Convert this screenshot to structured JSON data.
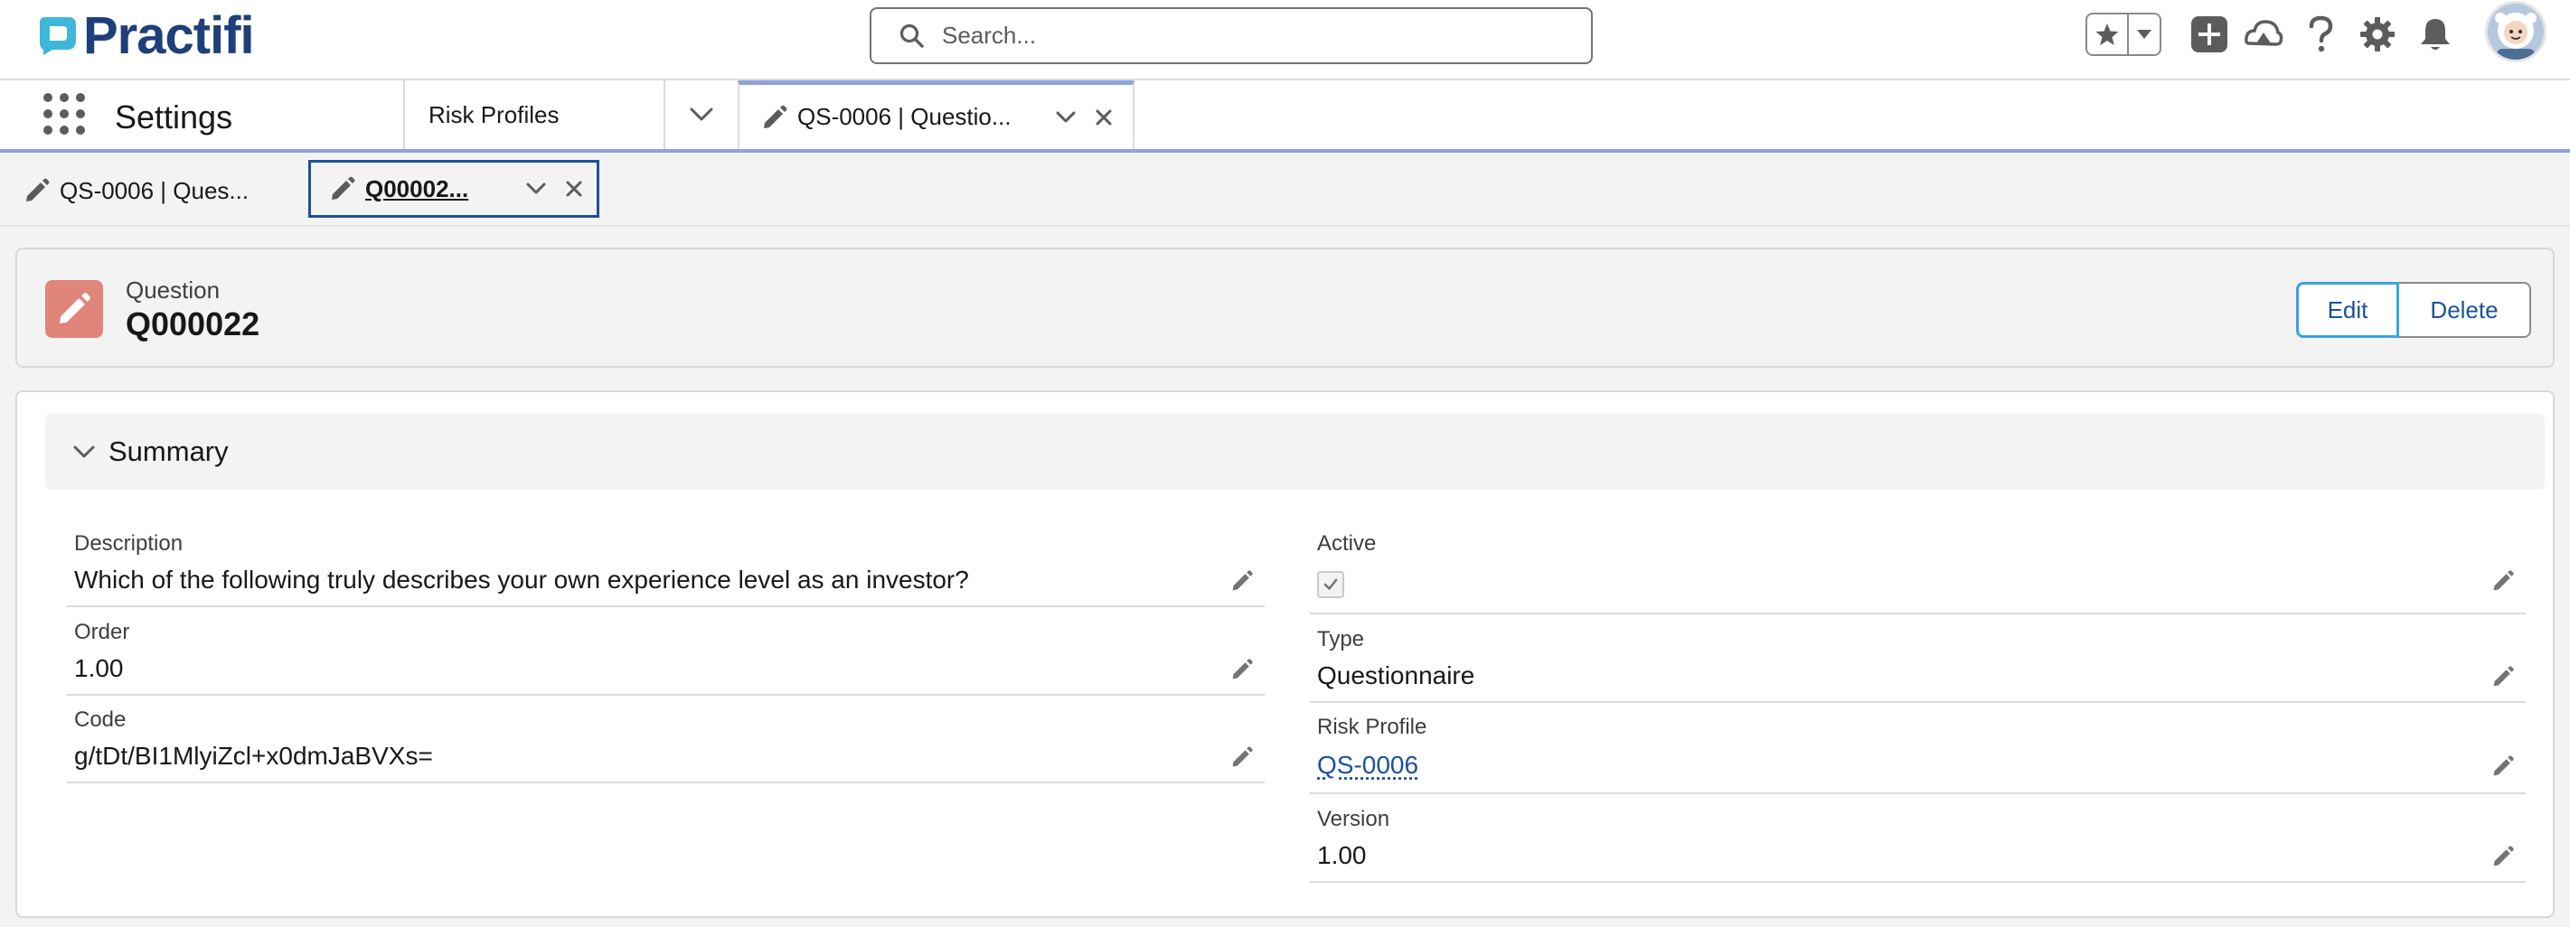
{
  "header": {
    "logo_text": "Practifi",
    "search": {
      "placeholder": "Search..."
    },
    "icons": [
      "favorites-star-icon",
      "chevron-down-icon",
      "add-icon",
      "trailhead-icon",
      "help-icon",
      "setup-gear-icon",
      "notifications-bell-icon",
      "avatar"
    ]
  },
  "app_nav": {
    "app_name": "Settings",
    "tabs": [
      {
        "label": "Risk Profiles"
      },
      {
        "label": "QS-0006 | Questio..."
      }
    ]
  },
  "subtabs": [
    {
      "label": "QS-0006 | Ques..."
    },
    {
      "label": "Q00002..."
    }
  ],
  "record": {
    "type_label": "Question",
    "title": "Q000022",
    "actions": {
      "edit": "Edit",
      "delete": "Delete"
    }
  },
  "summary": {
    "title": "Summary",
    "left_fields": [
      {
        "label": "Description",
        "value": "Which of the following truly describes your own experience level as an investor?"
      },
      {
        "label": "Order",
        "value": "1.00"
      },
      {
        "label": "Code",
        "value": "g/tDt/BI1MlyiZcl+x0dmJaBVXs="
      }
    ],
    "right_fields": [
      {
        "label": "Active",
        "checked": true
      },
      {
        "label": "Type",
        "value": "Questionnaire"
      },
      {
        "label": "Risk Profile",
        "value": "QS-0006"
      },
      {
        "label": "Version",
        "value": "1.00"
      }
    ]
  },
  "colors": {
    "brand": "#1f3f7a",
    "link": "#1b5297",
    "record_icon": "#e0857a",
    "tab_accent": "#8fa3dc"
  }
}
